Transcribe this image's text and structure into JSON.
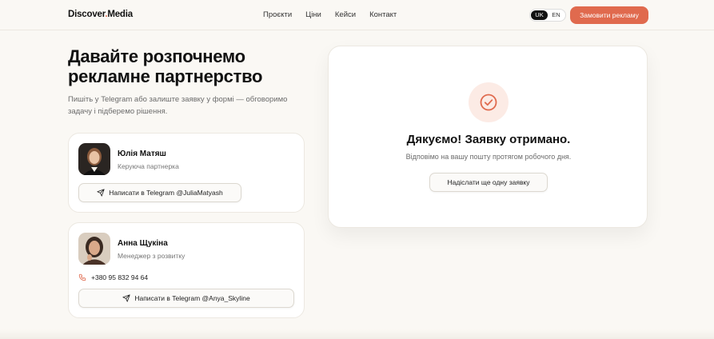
{
  "header": {
    "logo_main": "Discover",
    "logo_dot": ".",
    "logo_tail": "Media",
    "nav": [
      "Проєкти",
      "Ціни",
      "Кейси",
      "Контакт"
    ],
    "lang_active": "UK",
    "lang_other": "EN",
    "cta": "Замовити рекламу"
  },
  "left": {
    "title": "Давайте розпочнемо рекламне партнерство",
    "subtitle": "Пишіть у Telegram або залиште заявку у формі — обговоримо задачу і підберемо рішення.",
    "contacts": [
      {
        "name": "Юлія Матяш",
        "role": "Керуюча партнерка",
        "button": "Написати в Telegram @JuliaMatyash"
      },
      {
        "name": "Анна Щукіна",
        "role": "Менеджер з розвитку",
        "phone": "+380 95 832 94 64",
        "button": "Написати в Telegram @Anya_Skyline"
      }
    ]
  },
  "success": {
    "title": "Дякуємо! Заявку отримано.",
    "text": "Відповімо на вашу пошту протягом робочого дня.",
    "button": "Надіслати ще одну заявку",
    "icon": "check-circle-icon"
  },
  "colors": {
    "accent": "#e06a4e",
    "background": "#faf8f4"
  }
}
